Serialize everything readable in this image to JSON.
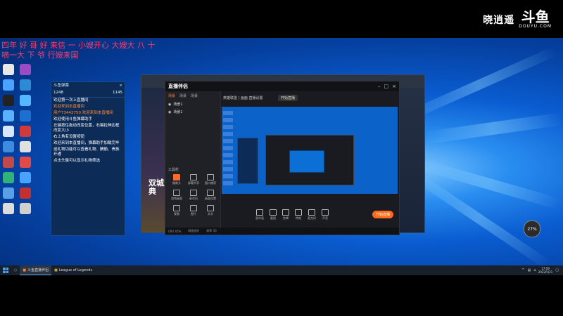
{
  "watermark": {
    "name": "晓逍遥",
    "logo": "斗鱼",
    "logo_sub": "DOUYU.COM"
  },
  "danmaku": {
    "line1": "四年  好 哥 好 来信  一 小嫂开心   大嫂大 八 十",
    "line2": "嘀一大 下 爷 行嫂来国"
  },
  "desktop_icons_left": [
    {
      "icon": "app-icon",
      "label": "",
      "color": "#e8e8e8"
    },
    {
      "icon": "tool-icon",
      "label": "",
      "color": "#4aa3ff"
    },
    {
      "icon": "qq-icon",
      "label": "",
      "color": "#222"
    },
    {
      "icon": "app-icon",
      "label": "",
      "color": "#5bb0ff"
    },
    {
      "icon": "document-icon",
      "label": "",
      "color": "#d9e6ff"
    },
    {
      "icon": "folder-icon",
      "label": "",
      "color": "#3c8de0"
    },
    {
      "icon": "game-icon",
      "label": "",
      "color": "#c04a4a"
    },
    {
      "icon": "edge-icon",
      "label": "",
      "color": "#2fb37a"
    },
    {
      "icon": "app-icon",
      "label": "",
      "color": "#5aa0e6"
    },
    {
      "icon": "app-icon",
      "label": "",
      "color": "#dcdcdc"
    }
  ],
  "desktop_icons_right": [
    {
      "icon": "app-icon",
      "label": "",
      "color": "#9a4cc4"
    },
    {
      "icon": "tool-icon",
      "label": "",
      "color": "#2d8ad4"
    },
    {
      "icon": "cloud-icon",
      "label": "",
      "color": "#54b8ff"
    },
    {
      "icon": "shield-icon",
      "label": "",
      "color": "#1e6fd0"
    },
    {
      "icon": "app-icon",
      "label": "",
      "color": "#d03a3a"
    },
    {
      "icon": "document-icon",
      "label": "",
      "color": "#e0e0e0"
    },
    {
      "icon": "target-icon",
      "label": "",
      "color": "#e24a4a"
    },
    {
      "icon": "app-icon",
      "label": "",
      "color": "#4aa3ff"
    },
    {
      "icon": "game-icon",
      "label": "",
      "color": "#c23030"
    },
    {
      "icon": "app-icon",
      "label": "",
      "color": "#cfcfcf"
    }
  ],
  "chat_panel": {
    "title": "斗鱼弹幕",
    "close": "×",
    "stat_left": "1248",
    "stat_right": "1145",
    "messages": [
      "欢迎第一次上直播间",
      "欢迎来到本直播间",
      "用户73442750 欢迎来到本直播间",
      "欢迎使用斗鱼弹幕助手",
      "左键按住拖动改变位置，右键拉伸边框改变大小",
      "右上角有设置按钮",
      "欢迎来到本直播间，弹幕助手加载完毕",
      "送礼物功能可以查看礼物、酬勤、贵族开通",
      "点击头像可以显示礼物筛选"
    ]
  },
  "game_window": {
    "title_line1": "双城之",
    "title_line2": "典"
  },
  "app_window": {
    "app_name": "直播伴侣",
    "tabs": [
      "场景",
      "场景",
      "场景"
    ],
    "scenes": [
      "场景1",
      "场景2"
    ],
    "section_label": "工具栏",
    "tools": [
      "摄像头",
      "屏幕共享",
      "窗口捕获",
      "游戏画面",
      "麦克风",
      "画面设置",
      "视频",
      "图片",
      "文字"
    ],
    "top_info": "英雄联盟 | 画面  直播设置",
    "live_button": "开始直播",
    "bottom_tools": [
      "画中画",
      "截图",
      "剪辑",
      "特效",
      "麦克风",
      "声音"
    ],
    "start_live": "开始直播",
    "status": [
      "CPU 45%",
      "网络良好",
      "帧率 30"
    ]
  },
  "float_ball": "27%",
  "taskbar": {
    "tasks": [
      "斗鱼直播伴侣",
      "League of Legends"
    ],
    "time": "17:09",
    "date": "2022/5/21"
  }
}
